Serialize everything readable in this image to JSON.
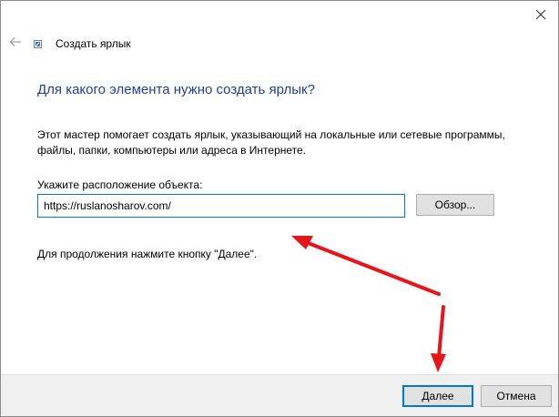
{
  "window": {
    "title": "Создать ярлык",
    "close_icon": "close-icon",
    "back_icon": "back-arrow-icon",
    "app_icon": "shortcut-wizard-icon"
  },
  "main": {
    "heading": "Для какого элемента нужно создать ярлык?",
    "description": "Этот мастер помогает создать ярлык, указывающий на локальные или сетевые программы, файлы, папки, компьютеры или адреса в Интернете.",
    "location_label": "Укажите расположение объекта:",
    "location_value": "https://ruslanosharov.com/",
    "browse_label": "Обзор...",
    "continue_hint": "Для продолжения нажмите кнопку \"Далее\"."
  },
  "footer": {
    "next_label": "Далее",
    "cancel_label": "Отмена"
  },
  "colors": {
    "heading": "#1e3e9c",
    "accent": "#0078d7",
    "annotation_arrow": "#e8141a"
  }
}
